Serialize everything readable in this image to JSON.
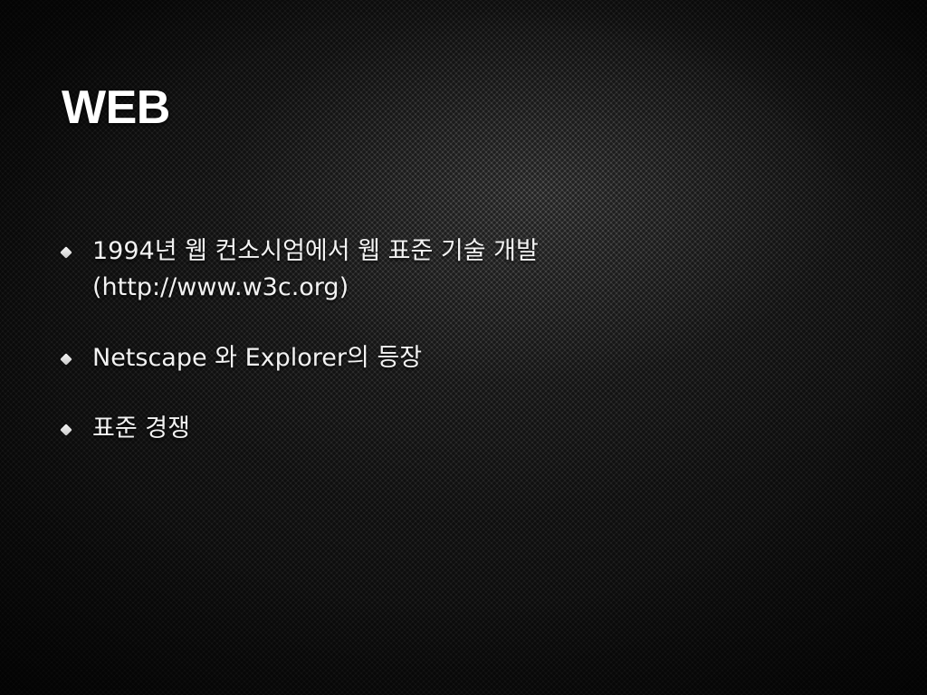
{
  "slide": {
    "title": "WEB",
    "bullets": [
      {
        "text": "1994년 웹 컨소시엄에서 웹 표준 기술 개발 (http://www.w3c.org)"
      },
      {
        "text": "Netscape 와 Explorer의 등장"
      },
      {
        "text": "표준 경쟁"
      }
    ]
  },
  "colors": {
    "background": "#1a1a1a",
    "text": "#ffffff"
  }
}
